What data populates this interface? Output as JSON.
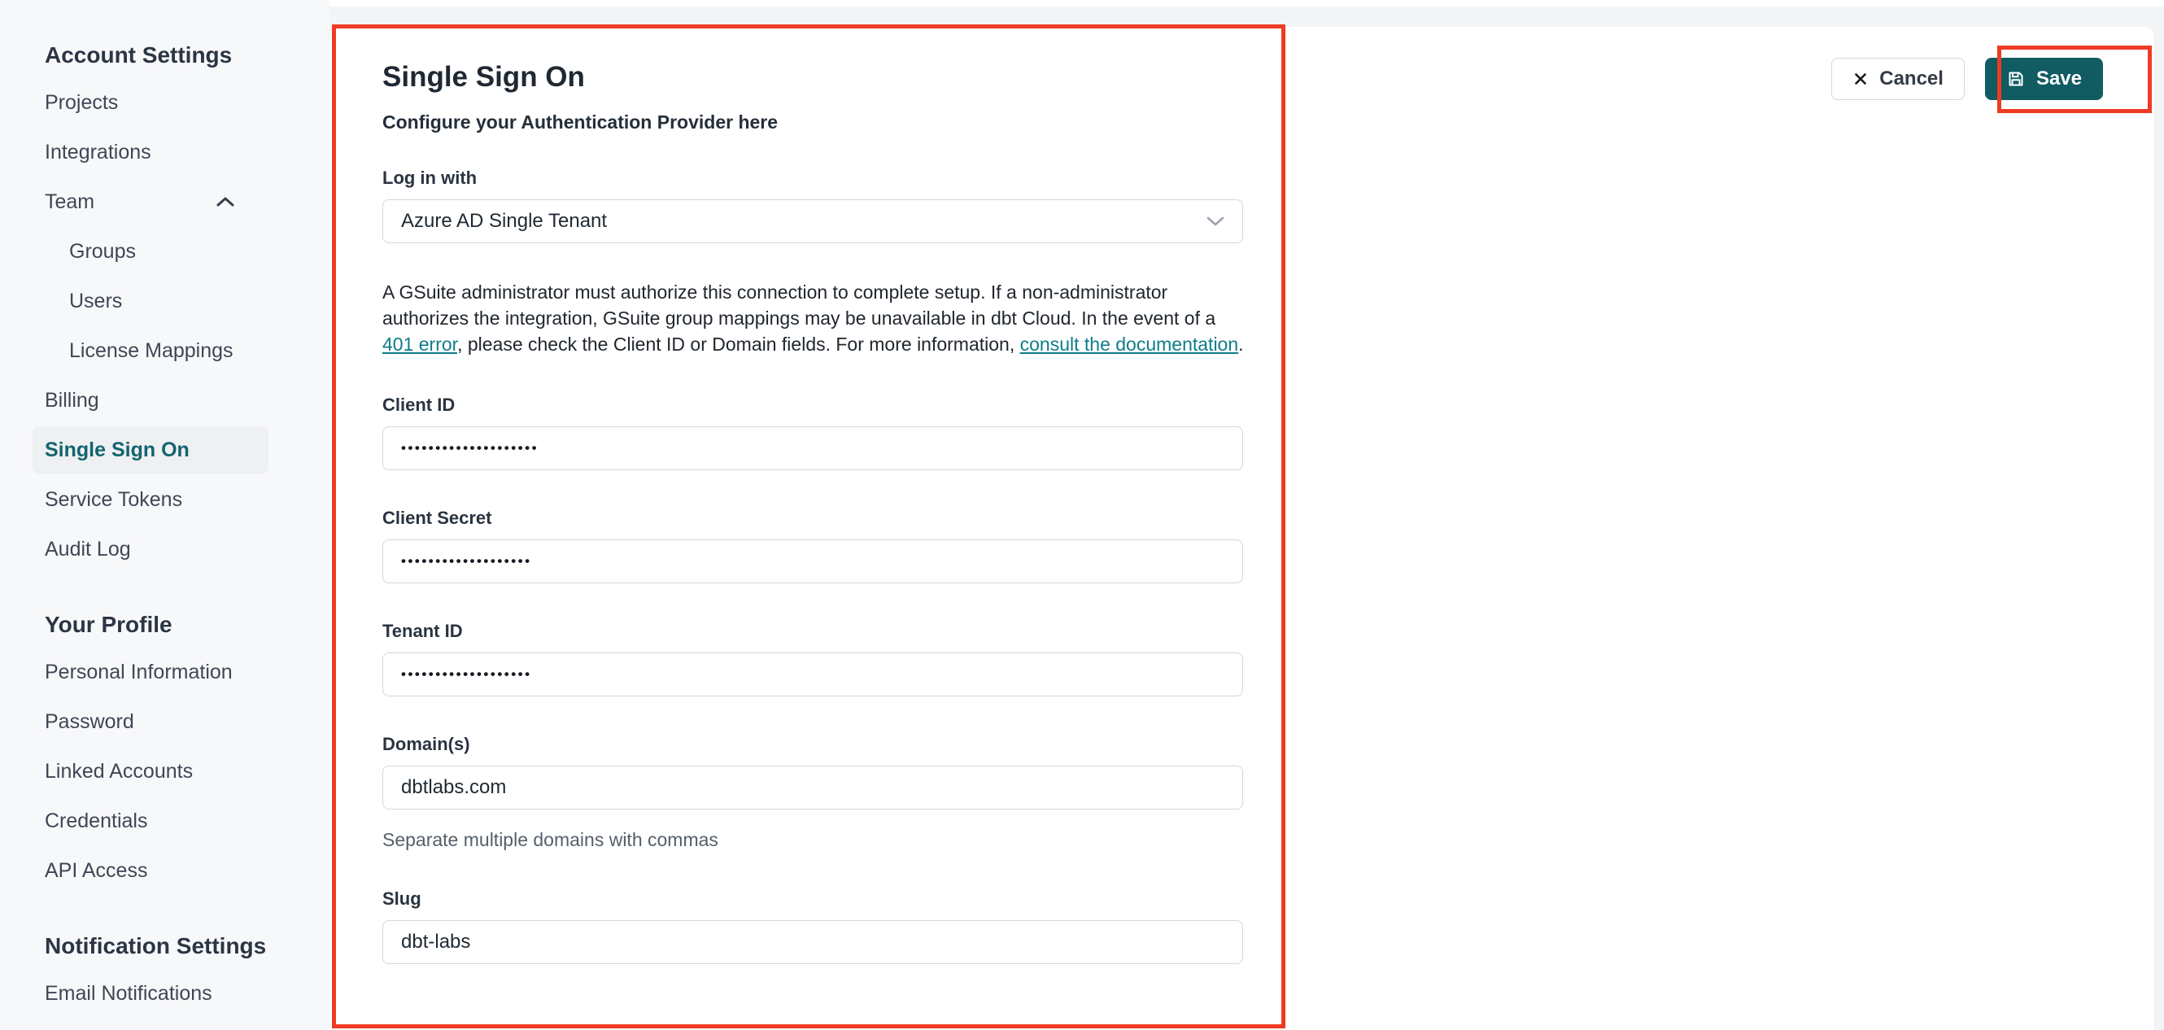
{
  "colors": {
    "annotation_red": "#ef3b24",
    "save_button_teal": "#115b63",
    "link_teal": "#0e7d89",
    "active_item_teal": "#14646e",
    "sidebar_bg": "#f7f8fa",
    "card_bg": "#ffffff"
  },
  "icons": {
    "cancel": "x-icon",
    "save": "floppy-disk-icon",
    "team_expand": "chevron-up-icon",
    "select": "chevron-down-icon"
  },
  "sidebar": {
    "sections": [
      {
        "heading": "Account Settings",
        "items": [
          {
            "label": "Projects"
          },
          {
            "label": "Integrations"
          },
          {
            "label": "Team"
          },
          {
            "label": "Groups"
          },
          {
            "label": "Users"
          },
          {
            "label": "License Mappings"
          },
          {
            "label": "Billing"
          },
          {
            "label": "Single Sign On"
          },
          {
            "label": "Service Tokens"
          },
          {
            "label": "Audit Log"
          }
        ]
      },
      {
        "heading": "Your Profile",
        "items": [
          {
            "label": "Personal Information"
          },
          {
            "label": "Password"
          },
          {
            "label": "Linked Accounts"
          },
          {
            "label": "Credentials"
          },
          {
            "label": "API Access"
          }
        ]
      },
      {
        "heading": "Notification Settings",
        "items": [
          {
            "label": "Email Notifications"
          }
        ]
      }
    ]
  },
  "main": {
    "title": "Single Sign On",
    "subtitle": "Configure your Authentication Provider here",
    "fields": {
      "login_with": {
        "label": "Log in with",
        "value": "Azure AD Single Tenant"
      },
      "client_id": {
        "label": "Client ID",
        "value": "••••••••••••••••••••"
      },
      "client_secret": {
        "label": "Client Secret",
        "value": "•••••••••••••••••••"
      },
      "tenant_id": {
        "label": "Tenant ID",
        "value": "•••••••••••••••••••"
      },
      "domains": {
        "label": "Domain(s)",
        "value": "dbtlabs.com",
        "helper": "Separate multiple domains with commas"
      },
      "slug": {
        "label": "Slug",
        "value": "dbt-labs"
      }
    },
    "paragraph": {
      "p1": "A GSuite administrator must authorize this connection to complete setup. If a non-administrator authorizes the integration, GSuite group mappings may be unavailable in dbt Cloud. In the event of a ",
      "link_401": "401 error",
      "p2": ", please check the Client ID or Domain fields. For more information, ",
      "link_docs": "consult the documentation",
      "p3": "."
    },
    "actions": {
      "cancel_label": "Cancel",
      "save_label": "Save"
    }
  }
}
